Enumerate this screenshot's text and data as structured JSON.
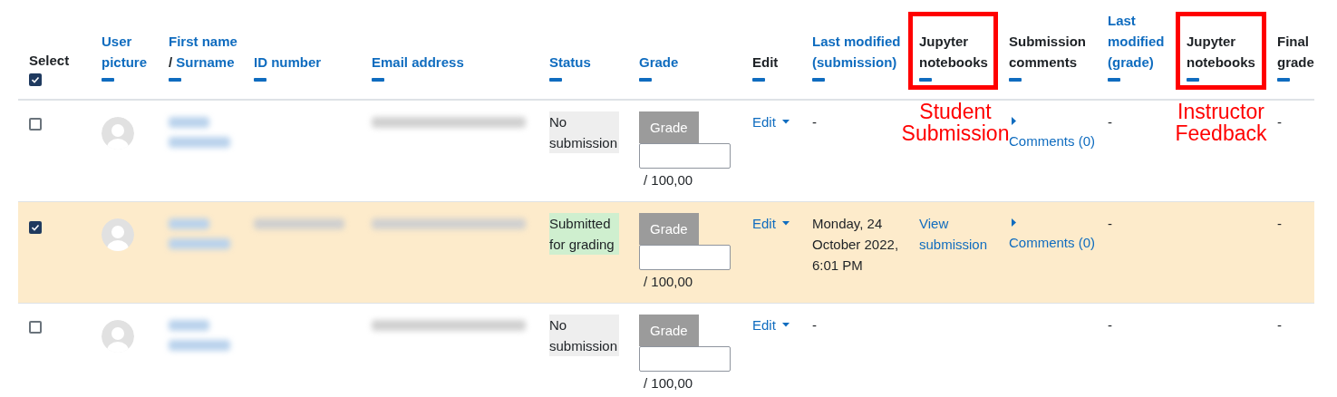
{
  "select_all": {
    "label": "Select",
    "checked": true
  },
  "columns": [
    {
      "parts": [
        {
          "text": "User picture",
          "link": true
        }
      ],
      "highlighted": false
    },
    {
      "parts": [
        {
          "text": "First name",
          "link": true
        },
        {
          "text": "/",
          "link": false
        },
        {
          "text": "Surname",
          "link": true
        }
      ],
      "highlighted": false
    },
    {
      "parts": [
        {
          "text": "ID number",
          "link": true
        }
      ],
      "highlighted": false
    },
    {
      "parts": [
        {
          "text": "Email address",
          "link": true
        }
      ],
      "highlighted": false
    },
    {
      "parts": [
        {
          "text": "Status",
          "link": true
        }
      ],
      "highlighted": false
    },
    {
      "parts": [
        {
          "text": "Grade",
          "link": true
        }
      ],
      "highlighted": false
    },
    {
      "parts": [
        {
          "text": "Edit",
          "link": false
        }
      ],
      "highlighted": false
    },
    {
      "parts": [
        {
          "text": "Last modified (submission)",
          "link": true
        }
      ],
      "highlighted": false
    },
    {
      "parts": [
        {
          "text": "Jupyter notebooks",
          "link": false
        }
      ],
      "highlighted": true,
      "annotation": "Student Submission"
    },
    {
      "parts": [
        {
          "text": "Submission comments",
          "link": false
        }
      ],
      "highlighted": false
    },
    {
      "parts": [
        {
          "text": "Last modified (grade)",
          "link": true
        }
      ],
      "highlighted": false
    },
    {
      "parts": [
        {
          "text": "Jupyter notebooks",
          "link": false
        }
      ],
      "highlighted": true,
      "annotation": "Instructor Feedback"
    },
    {
      "parts": [
        {
          "text": "Final grade",
          "link": false
        }
      ],
      "highlighted": false
    }
  ],
  "rows": [
    {
      "selected": false,
      "id_redacted": false,
      "status": {
        "text": "No submission",
        "kind": "none"
      },
      "grade_button": "Grade",
      "grade_max": "/ 100,00",
      "edit": "Edit",
      "modified": "-",
      "jupyter_sub": "",
      "comments": "Comments (0)",
      "modified_grade": "-",
      "final": "-"
    },
    {
      "selected": true,
      "id_redacted": true,
      "status": {
        "text": "Submitted for grading",
        "kind": "submitted"
      },
      "grade_button": "Grade",
      "grade_max": "/ 100,00",
      "edit": "Edit",
      "modified": "Monday, 24 October 2022, 6:01 PM",
      "jupyter_sub": "View submission",
      "comments": "Comments (0)",
      "modified_grade": "-",
      "final": "-"
    },
    {
      "selected": false,
      "id_redacted": false,
      "status": {
        "text": "No submission",
        "kind": "none"
      },
      "grade_button": "Grade",
      "grade_max": "/ 100,00",
      "edit": "Edit",
      "modified": "-",
      "jupyter_sub": "",
      "comments": "",
      "modified_grade": "-",
      "final": "-"
    }
  ]
}
